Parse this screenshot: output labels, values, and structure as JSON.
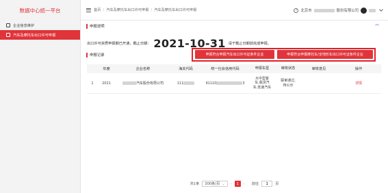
{
  "sidebar": {
    "brand": "数据中心统一平台",
    "items": [
      {
        "label": "企业信息维护",
        "active": false
      },
      {
        "label": "汽车及摩托车出口许可申报",
        "active": true
      }
    ]
  },
  "topbar": {
    "breadcrumb": [
      "首页",
      "汽车及摩托车出口许可申报",
      "汽车及摩托车出口许可申报"
    ],
    "company_prefix": "北京市",
    "company_suffix": "股份有限公司"
  },
  "notice_section": {
    "title": "申报说明",
    "text_before": "出口许可资质申报期已开通，截止日期：",
    "deadline": "2021-10-31",
    "text_after": "请于截止日期前完成申报。"
  },
  "records_section": {
    "title": "申报记录",
    "buttons": [
      "申报符合申报汽车出口许可证条件企业",
      "申报符合申报摩托车/全地形车出口许可证条件企业"
    ]
  },
  "table": {
    "columns": [
      "",
      "年度",
      "企业名称",
      "海关代码",
      "统一社会信用代码",
      "申报车型",
      "审核状态",
      "审核意见",
      "操作"
    ],
    "rows": [
      {
        "index": "1",
        "year": "2021",
        "company": "汽车股份有限公司",
        "customs_code": "111",
        "credit_code_prefix": "91110",
        "credit_code_suffix": "3",
        "vehicle_type": [
          "大中型客",
          "车,载货汽",
          "车,低速汽车"
        ],
        "status": [
          "联审通过,",
          "待公示"
        ],
        "opinion": "",
        "action": "详情"
      }
    ]
  },
  "pagination": {
    "total": "共1条",
    "page_size": "300条/页",
    "current_page": "1",
    "goto_label": "前往",
    "goto_value": "1",
    "page_suffix": "页"
  },
  "colors": {
    "accent": "#e0343a",
    "highlight_frame": "#e41e26"
  }
}
